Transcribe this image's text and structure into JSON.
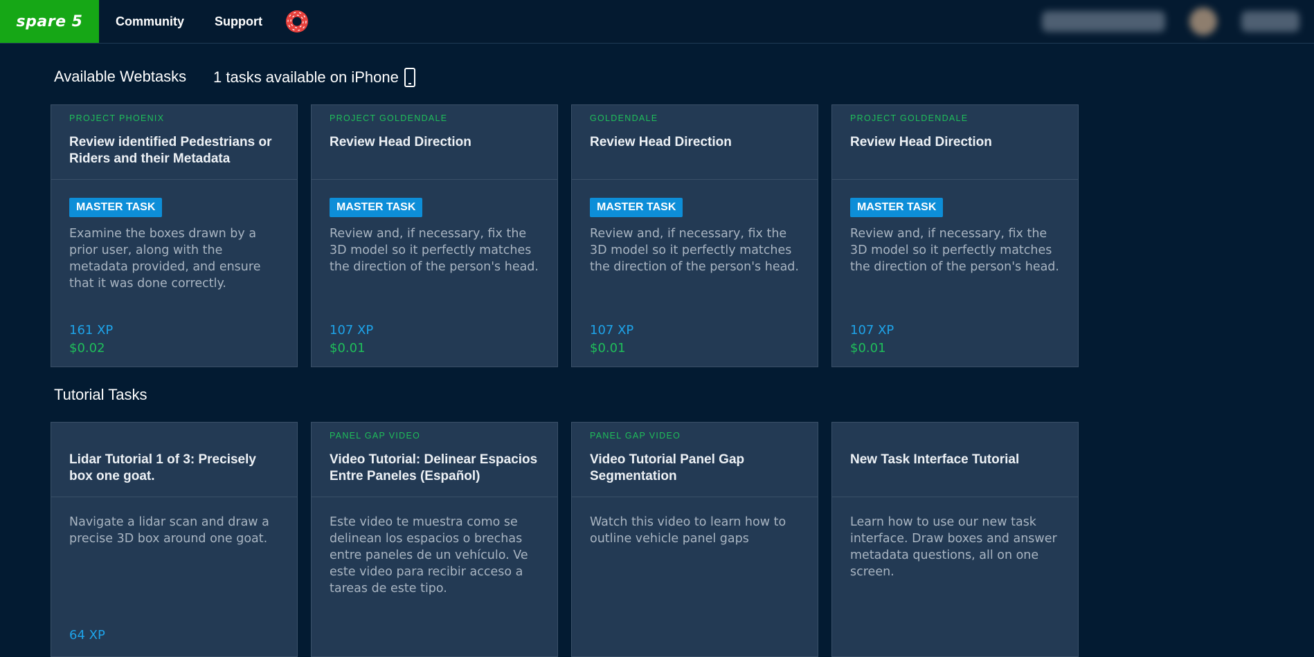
{
  "header": {
    "logo": "spare 5",
    "nav": {
      "community": "Community",
      "support": "Support"
    }
  },
  "sections": {
    "available": "Available Webtasks",
    "iphone": "1 tasks available on iPhone",
    "tutorial": "Tutorial Tasks"
  },
  "colors": {
    "background": "#031b32",
    "card": "#233a54",
    "accent_green": "#1fbf5a",
    "accent_blue": "#1ea4ea",
    "badge_blue": "#0d8ed8",
    "logo_green": "#16a716"
  },
  "webtasks": [
    {
      "project": "PROJECT PHOENIX",
      "title": "Review identified Pedestrians or Riders and their Metadata",
      "badge": "MASTER TASK",
      "description": "Examine the boxes drawn by a prior user, along with the metadata provided, and ensure that it was done correctly.",
      "xp": "161 XP",
      "pay": "$0.02"
    },
    {
      "project": "PROJECT GOLDENDALE",
      "title": "Review Head Direction",
      "badge": "MASTER TASK",
      "description": "Review and, if necessary, fix the 3D model so it perfectly matches the direction of the person's head.",
      "xp": "107 XP",
      "pay": "$0.01"
    },
    {
      "project": "GOLDENDALE",
      "title": "Review Head Direction",
      "badge": "MASTER TASK",
      "description": "Review and, if necessary, fix the 3D model so it perfectly matches the direction of the person's head.",
      "xp": "107 XP",
      "pay": "$0.01"
    },
    {
      "project": "PROJECT GOLDENDALE",
      "title": "Review Head Direction",
      "badge": "MASTER TASK",
      "description": "Review and, if necessary, fix the 3D model so it perfectly matches the direction of the person's head.",
      "xp": "107 XP",
      "pay": "$0.01"
    }
  ],
  "tutorials": [
    {
      "project": "",
      "title": "Lidar Tutorial 1 of 3: Precisely box one goat.",
      "description": "Navigate a lidar scan and draw a precise 3D box around one goat.",
      "xp": "64 XP"
    },
    {
      "project": "PANEL GAP VIDEO",
      "title": "Video Tutorial: Delinear Espacios Entre Paneles (Español)",
      "description": "Este video te muestra como se delinean los espacios o brechas entre paneles de un vehículo. Ve este video para recibir acceso a tareas de este tipo."
    },
    {
      "project": "PANEL GAP VIDEO",
      "title": "Video Tutorial Panel Gap Segmentation",
      "description": "Watch this video to learn how to outline vehicle panel gaps"
    },
    {
      "project": "",
      "title": "New Task Interface Tutorial",
      "description": "Learn how to use our new task interface. Draw boxes and answer metadata questions, all on one screen."
    }
  ]
}
